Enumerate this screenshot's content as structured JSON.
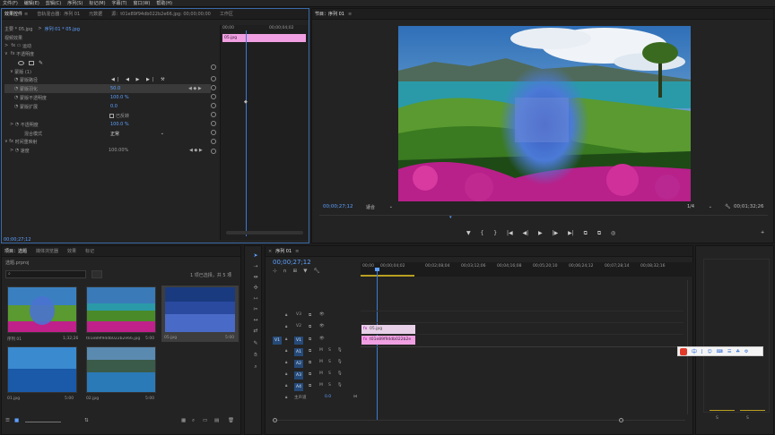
{
  "menu": [
    "文件(F)",
    "编辑(E)",
    "剪辑(C)",
    "序列(S)",
    "标记(M)",
    "字幕(T)",
    "窗口(W)",
    "帮助(H)"
  ],
  "effect_controls": {
    "tabs": [
      "效果控件",
      "音轨混合器：序列 01",
      "元数据",
      "源：t01e89f94db022b2e66.jpg: 00;00;00;00",
      "工作区"
    ],
    "tabs_icon_label": "≡",
    "clip_path": "主要 * 05.jpg",
    "seq_tab": "序列 01 * 05.jpg",
    "section_video": "视频效果",
    "motion": "运动",
    "opacity_group": "不透明度",
    "mask_group": "蒙版 (1)",
    "mask_path": "蒙版路径",
    "mask_feather": "蒙版羽化",
    "mask_feather_val": "50.0",
    "mask_opacity": "蒙版不透明度",
    "mask_opacity_val": "100.0 %",
    "mask_expansion": "蒙版扩展",
    "mask_expansion_val": "0.0",
    "inverted": "已反转",
    "opacity": "不透明度",
    "opacity_val": "100.0 %",
    "blend_mode": "混合模式",
    "blend_val": "正常",
    "time_remap": "时间重映射",
    "speed": "速度",
    "speed_val": "100.00%",
    "clip_bar": "05.jpg",
    "ruler_start": "00;00",
    "ruler_end": "00;00;04;02",
    "timecode": "00;00;27;12"
  },
  "program": {
    "tab": "节目：序列 01",
    "tab_icon": "≡",
    "timecode": "00;00;27;12",
    "fit": "适合",
    "quality": "1/4",
    "duration": "00;01;32;26"
  },
  "project": {
    "tabs": [
      "项目：选题",
      "媒体浏览器",
      "效果",
      "标记"
    ],
    "project_file": "选题.prproj",
    "search_placeholder": "",
    "selected_info": "1 项已选择，共 5 项",
    "items": [
      {
        "name": "序列 01",
        "dur": "1;32;26"
      },
      {
        "name": "t01e89f94db022b2e66.jpg",
        "dur": "5:00"
      },
      {
        "name": "05.jpg",
        "dur": "5:00"
      },
      {
        "name": "01.jpg",
        "dur": "5:00"
      },
      {
        "name": "02.jpg",
        "dur": "5:00"
      }
    ]
  },
  "timeline": {
    "tab": "序列 01",
    "tab_icon": "≡",
    "timecode": "00;00;27;12",
    "ruler": [
      "00;00",
      "00;00;04;02",
      "00;02;08;04",
      "00;03;12;06",
      "00;04;16;08",
      "00;05;20;10",
      "00;06;24;12",
      "00;07;28;14",
      "00;08;32;16"
    ],
    "tracks_video": [
      "V3",
      "V2",
      "V1"
    ],
    "tracks_audio": [
      "A1",
      "A2",
      "A3",
      "A4"
    ],
    "source_v": "V1",
    "master": "主声道",
    "master_val": "0.0",
    "clip_top": "05.jpg",
    "clip_bottom": "t01e89f94db022b2e",
    "m_label": "M",
    "s_label": "S"
  },
  "meter": {
    "labels": [
      "S",
      "S"
    ]
  },
  "ime": {
    "chars": [
      "中",
      "J",
      "☺",
      "⌨",
      "☰",
      "☘",
      "⚙"
    ]
  },
  "colors": {
    "accent": "#5ca0ff",
    "clip_pink": "#f0a0e2",
    "panel": "#232323"
  }
}
